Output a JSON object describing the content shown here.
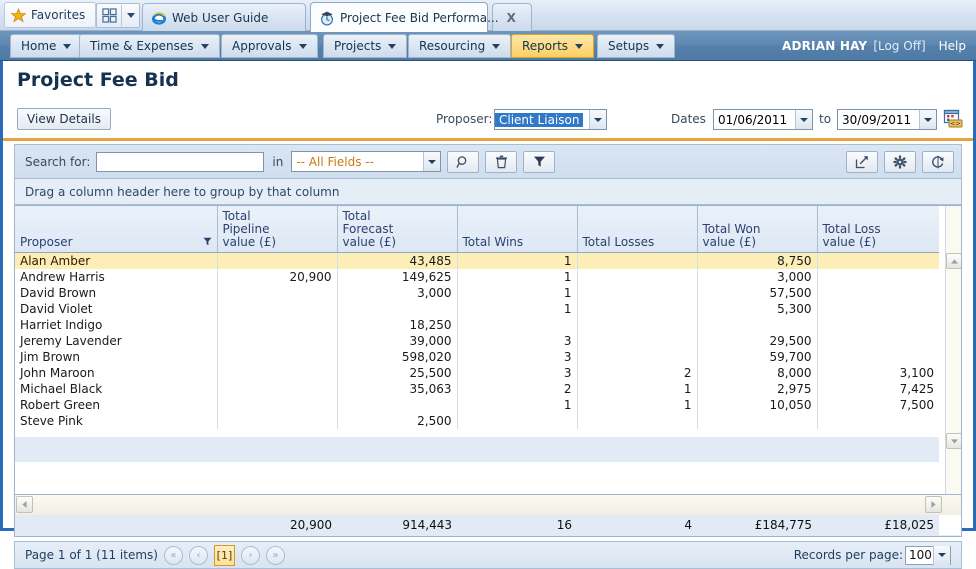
{
  "browser": {
    "favorites_label": "Favorites",
    "favorites_icon": "star-icon",
    "quicktabs_icon": "grid-tiles-icon",
    "tabs": [
      {
        "label": "Web User Guide",
        "icon": "internet-explorer-icon",
        "active": false,
        "closable": false
      },
      {
        "label": "Project Fee Bid Performa...",
        "icon": "app-clock-icon",
        "active": true,
        "closable": true,
        "close_glyph": "X"
      }
    ]
  },
  "appbar": {
    "menus": [
      {
        "label": "Home",
        "selected": false
      },
      {
        "label": "Time & Expenses",
        "selected": false
      },
      {
        "label": "Approvals",
        "selected": false
      },
      {
        "label": "Projects",
        "selected": false
      },
      {
        "label": "Resourcing",
        "selected": false
      },
      {
        "label": "Reports",
        "selected": true
      },
      {
        "label": "Setups",
        "selected": false
      }
    ],
    "user_name": "ADRIAN HAY",
    "log_off": "[Log Off]",
    "help": "Help",
    "selected_color": "#fccf62",
    "bar_color": "#5580ab"
  },
  "page": {
    "title": "Project Fee Bid",
    "accent_rule_color": "#e8a33d"
  },
  "toolbar": {
    "view_details_label": "View Details",
    "proposer_label": "Proposer:",
    "proposer_value": "Client Liaison",
    "proposer_value_highlighted": true,
    "dates_label": "Dates",
    "date_from": "01/06/2011",
    "date_to": "30/09/2011",
    "to_label": "to",
    "date_picker_icon": "date-range-picker-icon"
  },
  "search": {
    "search_for_label": "Search for:",
    "search_value": "",
    "search_placeholder": "",
    "in_label": "in",
    "field_selector_value": "-- All Fields --",
    "buttons": [
      {
        "name": "search-button",
        "icon": "magnifier-icon"
      },
      {
        "name": "clear-button",
        "icon": "trash-icon"
      },
      {
        "name": "filter-button",
        "icon": "funnel-icon"
      }
    ],
    "right_buttons": [
      {
        "name": "export-button",
        "icon": "export-arrow-icon"
      },
      {
        "name": "settings-button",
        "icon": "gear-icon"
      },
      {
        "name": "refresh-button",
        "icon": "refresh-icon"
      }
    ]
  },
  "group_panel": {
    "hint": "Drag a column header here to group by that column"
  },
  "chart_data": {
    "type": "table",
    "title": "Project Fee Bid",
    "columns": [
      "Proposer",
      "Total Pipeline value (£)",
      "Total Forecast value (£)",
      "Total Wins",
      "Total Losses",
      "Total Won value (£)",
      "Total Loss value (£)"
    ],
    "rows": [
      {
        "proposer": "Alan Amber",
        "pipeline": "",
        "forecast": "43,485",
        "wins": "1",
        "losses": "",
        "won": "8,750",
        "loss": "",
        "highlighted": true
      },
      {
        "proposer": "Andrew Harris",
        "pipeline": "20,900",
        "forecast": "149,625",
        "wins": "1",
        "losses": "",
        "won": "3,000",
        "loss": "",
        "highlighted": false
      },
      {
        "proposer": "David Brown",
        "pipeline": "",
        "forecast": "3,000",
        "wins": "1",
        "losses": "",
        "won": "57,500",
        "loss": "",
        "highlighted": false
      },
      {
        "proposer": "David Violet",
        "pipeline": "",
        "forecast": "",
        "wins": "1",
        "losses": "",
        "won": "5,300",
        "loss": "",
        "highlighted": false
      },
      {
        "proposer": "Harriet Indigo",
        "pipeline": "",
        "forecast": "18,250",
        "wins": "",
        "losses": "",
        "won": "",
        "loss": "",
        "highlighted": false
      },
      {
        "proposer": "Jeremy Lavender",
        "pipeline": "",
        "forecast": "39,000",
        "wins": "3",
        "losses": "",
        "won": "29,500",
        "loss": "",
        "highlighted": false
      },
      {
        "proposer": "Jim Brown",
        "pipeline": "",
        "forecast": "598,020",
        "wins": "3",
        "losses": "",
        "won": "59,700",
        "loss": "",
        "highlighted": false
      },
      {
        "proposer": "John Maroon",
        "pipeline": "",
        "forecast": "25,500",
        "wins": "3",
        "losses": "2",
        "won": "8,000",
        "loss": "3,100",
        "highlighted": false
      },
      {
        "proposer": "Michael Black",
        "pipeline": "",
        "forecast": "35,063",
        "wins": "2",
        "losses": "1",
        "won": "2,975",
        "loss": "7,425",
        "highlighted": false
      },
      {
        "proposer": "Robert Green",
        "pipeline": "",
        "forecast": "",
        "wins": "1",
        "losses": "1",
        "won": "10,050",
        "loss": "7,500",
        "highlighted": false
      },
      {
        "proposer": "Steve Pink",
        "pipeline": "",
        "forecast": "2,500",
        "wins": "",
        "losses": "",
        "won": "",
        "loss": "",
        "highlighted": false
      }
    ],
    "totals": {
      "proposer": "",
      "pipeline": "20,900",
      "forecast": "914,443",
      "wins": "16",
      "losses": "4",
      "won": "£184,775",
      "loss": "£18,025"
    }
  },
  "grid_headers": [
    {
      "lines": [
        "Proposer"
      ],
      "has_filter_icon": true
    },
    {
      "lines": [
        "Total",
        "Pipeline",
        "value (£)"
      ],
      "has_filter_icon": false
    },
    {
      "lines": [
        "Total",
        "Forecast",
        "value (£)"
      ],
      "has_filter_icon": false
    },
    {
      "lines": [
        "Total Wins"
      ],
      "has_filter_icon": false
    },
    {
      "lines": [
        "Total Losses"
      ],
      "has_filter_icon": false
    },
    {
      "lines": [
        "Total Won",
        "value (£)"
      ],
      "has_filter_icon": false
    },
    {
      "lines": [
        "Total Loss",
        "value (£)"
      ],
      "has_filter_icon": false
    }
  ],
  "pager": {
    "summary": "Page 1 of 1 (11 items)",
    "first_glyph": "«",
    "prev_glyph": "‹",
    "current_page": "[1]",
    "next_glyph": "›",
    "last_glyph": "»",
    "records_per_page_label": "Records per page:",
    "records_per_page_value": "100"
  }
}
